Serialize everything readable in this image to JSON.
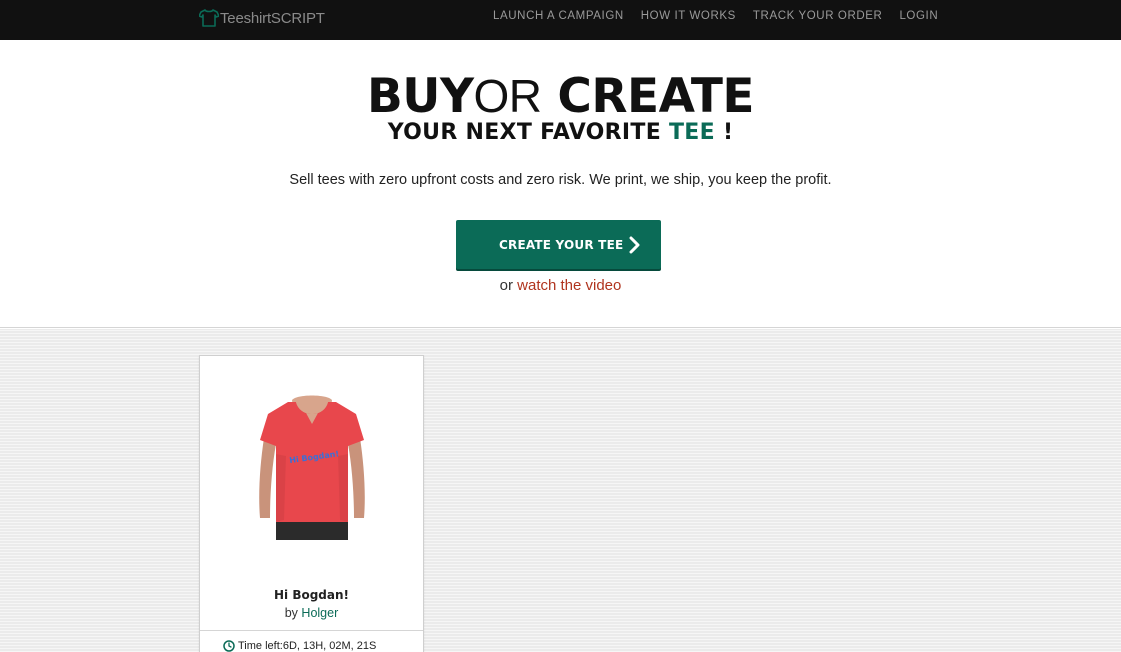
{
  "brand": {
    "name": "TeeshirtSCRIPT",
    "logo_icon": "tshirt-icon",
    "logo_color": "#0b6b57"
  },
  "nav": {
    "items": [
      {
        "label": "LAUNCH A CAMPAIGN"
      },
      {
        "label": "HOW IT WORKS"
      },
      {
        "label": "TRACK YOUR ORDER"
      },
      {
        "label": "LOGIN"
      }
    ]
  },
  "hero": {
    "headline_buy": "BUY",
    "headline_or": "OR",
    "headline_create": "CREATE",
    "subhead_main": "YOUR NEXT FAVORITE",
    "subhead_accent": "TEE",
    "subhead_end": "!",
    "tagline": "Sell tees with zero upfront costs and zero risk. We print, we ship, you keep the profit.",
    "cta_label": "CREATE YOUR TEE",
    "cta_icon": "chevron-right-icon",
    "video_prefix": "or",
    "video_link": "watch the video"
  },
  "campaigns": [
    {
      "title": "Hi Bogdan!",
      "shirt_print": "Hi Bogdan!",
      "by_label": "by",
      "author": "Holger",
      "time_left": "Time left:6D, 13H, 02M, 21S",
      "shirt_color": "#e8474c"
    }
  ],
  "colors": {
    "accent": "#0b6b57",
    "link_red": "#b0341e",
    "topbar": "#111111"
  }
}
